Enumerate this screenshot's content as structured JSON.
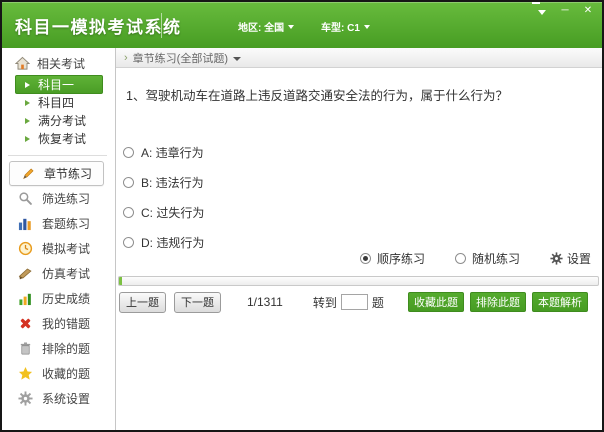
{
  "window": {
    "title": "科目一模拟考试系统",
    "region": "地区: 全国",
    "vehicle": "车型: C1",
    "minimize_glyph": "─",
    "close_glyph": "✕"
  },
  "colors": {
    "accent_green": "#4aa227",
    "titlebar_top": "#68bb3d",
    "titlebar_bottom": "#479d23",
    "progress_fill": "#7cc142",
    "wrong_red": "#d43222",
    "star_yellow": "#f2c11e"
  },
  "sidebar": {
    "related": {
      "header": "相关考试",
      "items": [
        {
          "label": "科目一",
          "selected": true
        },
        {
          "label": "科目四",
          "selected": false
        },
        {
          "label": "满分考试",
          "selected": false
        },
        {
          "label": "恢复考试",
          "selected": false
        }
      ]
    },
    "menu": [
      {
        "label": "章节练习",
        "icon": "pencil-icon",
        "active": true
      },
      {
        "label": "筛选练习",
        "icon": "magnifier-icon",
        "active": false
      },
      {
        "label": "套题练习",
        "icon": "exam-set-icon",
        "active": false
      },
      {
        "label": "模拟考试",
        "icon": "clock-icon",
        "active": false
      },
      {
        "label": "仿真考试",
        "icon": "brush-icon",
        "active": false
      },
      {
        "label": "历史成绩",
        "icon": "stats-icon",
        "active": false
      },
      {
        "label": "我的错题",
        "icon": "wrong-icon",
        "active": false
      },
      {
        "label": "排除的题",
        "icon": "trash-icon",
        "active": false
      },
      {
        "label": "收藏的题",
        "icon": "star-icon",
        "active": false
      },
      {
        "label": "系统设置",
        "icon": "gear-icon",
        "active": false
      }
    ]
  },
  "main": {
    "breadcrumb": "章节练习(全部试题)",
    "question": "1、驾驶机动车在道路上违反道路交通安全法的行为，属于什么行为？",
    "options": [
      {
        "text": "A: 违章行为",
        "selected": false
      },
      {
        "text": "B: 违法行为",
        "selected": false
      },
      {
        "text": "C: 过失行为",
        "selected": false
      },
      {
        "text": "D: 违规行为",
        "selected": false
      }
    ],
    "modes": [
      {
        "label": "顺序练习",
        "selected": true
      },
      {
        "label": "随机练习",
        "selected": false
      }
    ],
    "settings_label": "设置",
    "progress": {
      "current": 1,
      "total": 1311,
      "percent": 0.6
    },
    "nav": {
      "prev": "上一题",
      "next": "下一题",
      "counter": "1/1311",
      "goto_label": "转到",
      "goto_suffix": "题",
      "goto_value": ""
    },
    "actions": [
      "收藏此题",
      "排除此题",
      "本题解析"
    ]
  }
}
